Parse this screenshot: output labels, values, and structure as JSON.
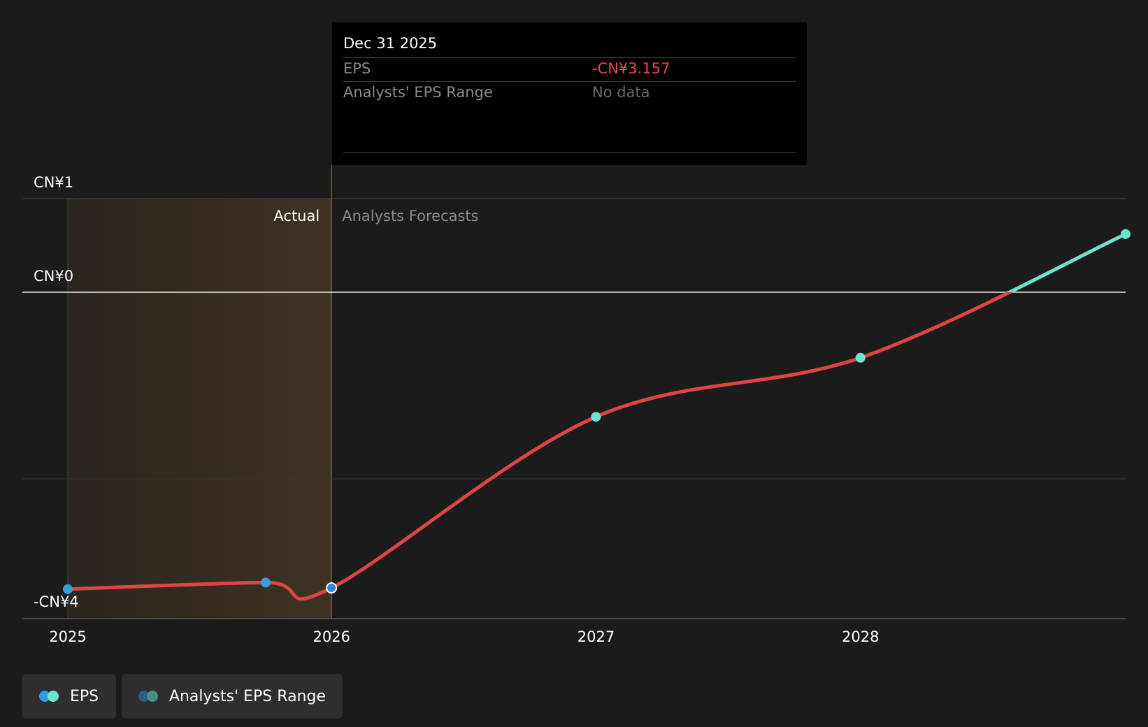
{
  "chart_data": {
    "type": "line",
    "title": "",
    "xlabel": "",
    "ylabel": "",
    "x_ticks": [
      "2025",
      "2026",
      "2027",
      "2028"
    ],
    "y_ticks": [
      {
        "value": 1,
        "label": "CN¥1"
      },
      {
        "value": 0,
        "label": "CN¥0"
      },
      {
        "value": -4,
        "label": "-CN¥4"
      }
    ],
    "xlim": [
      "2025-01-01",
      "2028-12-31"
    ],
    "ylim": [
      -4.5,
      1
    ],
    "grid": true,
    "region_labels": {
      "actual": "Actual",
      "forecast": "Analysts Forecasts"
    },
    "series": [
      {
        "name": "EPS",
        "points": [
          {
            "x": "2025-01-01",
            "y": -3.17,
            "kind": "actual"
          },
          {
            "x": "2025-10-01",
            "y": -3.1,
            "kind": "actual"
          },
          {
            "x": "2025-12-31",
            "y": -3.157,
            "kind": "actual"
          },
          {
            "x": "2026-12-31",
            "y": -1.33,
            "kind": "forecast"
          },
          {
            "x": "2027-12-31",
            "y": -0.7,
            "kind": "forecast"
          },
          {
            "x": "2028-12-31",
            "y": 0.62,
            "kind": "forecast"
          }
        ],
        "colors": {
          "negative": "#e04444",
          "positive": "#6ee3cf",
          "actual_marker": "#3a9ce0",
          "forecast_marker": "#6ee3cf"
        }
      }
    ],
    "tooltip": {
      "date": "Dec 31 2025",
      "rows": [
        {
          "label": "EPS",
          "value": "-CN¥3.157",
          "color": "#e84a50"
        },
        {
          "label": "Analysts' EPS Range",
          "value": "No data",
          "color": "#6a6a6a"
        }
      ]
    },
    "legend": [
      {
        "label": "EPS",
        "colors": [
          "#2f9ee6",
          "#6ee3cf"
        ]
      },
      {
        "label": "Analysts' EPS Range",
        "colors": [
          "#2a5f86",
          "#4a8f86"
        ]
      }
    ]
  }
}
